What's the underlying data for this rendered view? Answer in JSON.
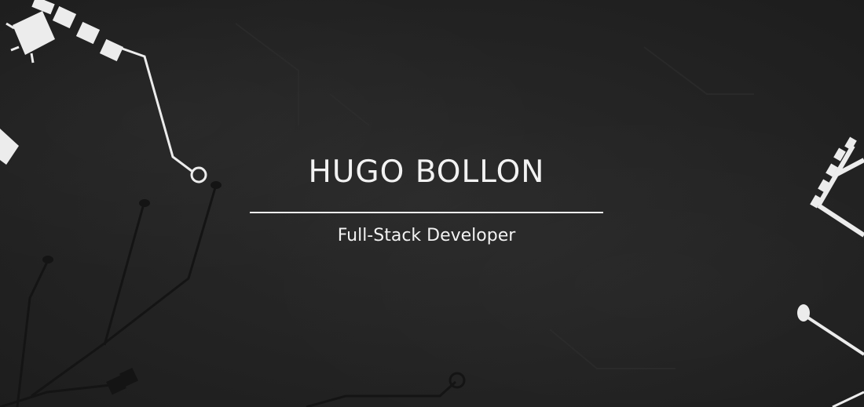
{
  "hero": {
    "name": "HUGO BOLLON",
    "role": "Full-Stack Developer"
  },
  "colors": {
    "background": "#242424",
    "text": "#f2f2f2",
    "circuit_light": "#ececec",
    "circuit_dark": "#151515"
  }
}
